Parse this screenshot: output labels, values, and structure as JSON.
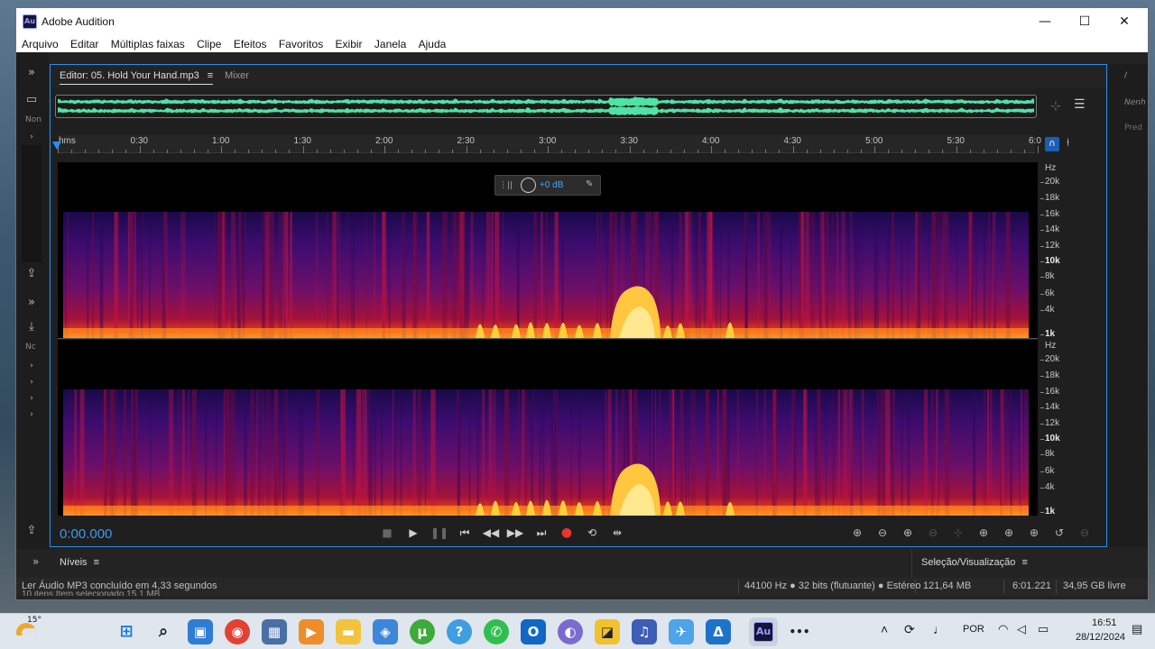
{
  "window": {
    "title": "Adobe Audition",
    "logo": "Au",
    "minimize": "—",
    "maximize": "☐",
    "close": "✕"
  },
  "menu": [
    "Arquivo",
    "Editar",
    "Múltiplas faixas",
    "Clipe",
    "Efeitos",
    "Favoritos",
    "Exibir",
    "Janela",
    "Ajuda"
  ],
  "left_panel": {
    "files_label": "Non",
    "nested_label": "Nc"
  },
  "editor": {
    "tab_label": "Editor: 05. Hold Your Hand.mp3",
    "tab_menu": "≡",
    "mixer_label": "Mixer"
  },
  "ruler": {
    "labels": [
      "hms",
      "0:30",
      "1:00",
      "1:30",
      "2:00",
      "2:30",
      "3:00",
      "3:30",
      "4:00",
      "4:30",
      "5:00",
      "5:30",
      "6:0"
    ]
  },
  "hud": {
    "gain_value": "+0 dB"
  },
  "freq_axis": {
    "unit": "Hz",
    "labels": [
      "20k",
      "18k",
      "16k",
      "14k",
      "12k",
      "10k",
      "8k",
      "6k",
      "4k",
      "1k"
    ]
  },
  "transport": {
    "time": "0:00.000"
  },
  "panels": {
    "levels": "Níveis",
    "selection": "Seleção/Visualização",
    "right_header": "Nenh",
    "right_sub": "Pred"
  },
  "status": {
    "message": "Ler Áudio MP3 concluído em 4,33 segundos",
    "behind_message": "10 itens    Item selecionado 15,1 MB",
    "sample_info": "44100 Hz ● 32 bits (flutuante) ● Estéreo",
    "size": "121,64 MB",
    "duration": "6:01.221",
    "free": "34,95 GB livre"
  },
  "taskbar": {
    "weather_temp": "15°",
    "language": "POR",
    "clock_time": "16:51",
    "clock_date": "28/12/2024",
    "more": "•••"
  },
  "colors": {
    "accent": "#2d8ceb",
    "waveform": "#4fe3a4",
    "spectral_low": "#3a0a6a",
    "spectral_high": "#ffd24a"
  }
}
